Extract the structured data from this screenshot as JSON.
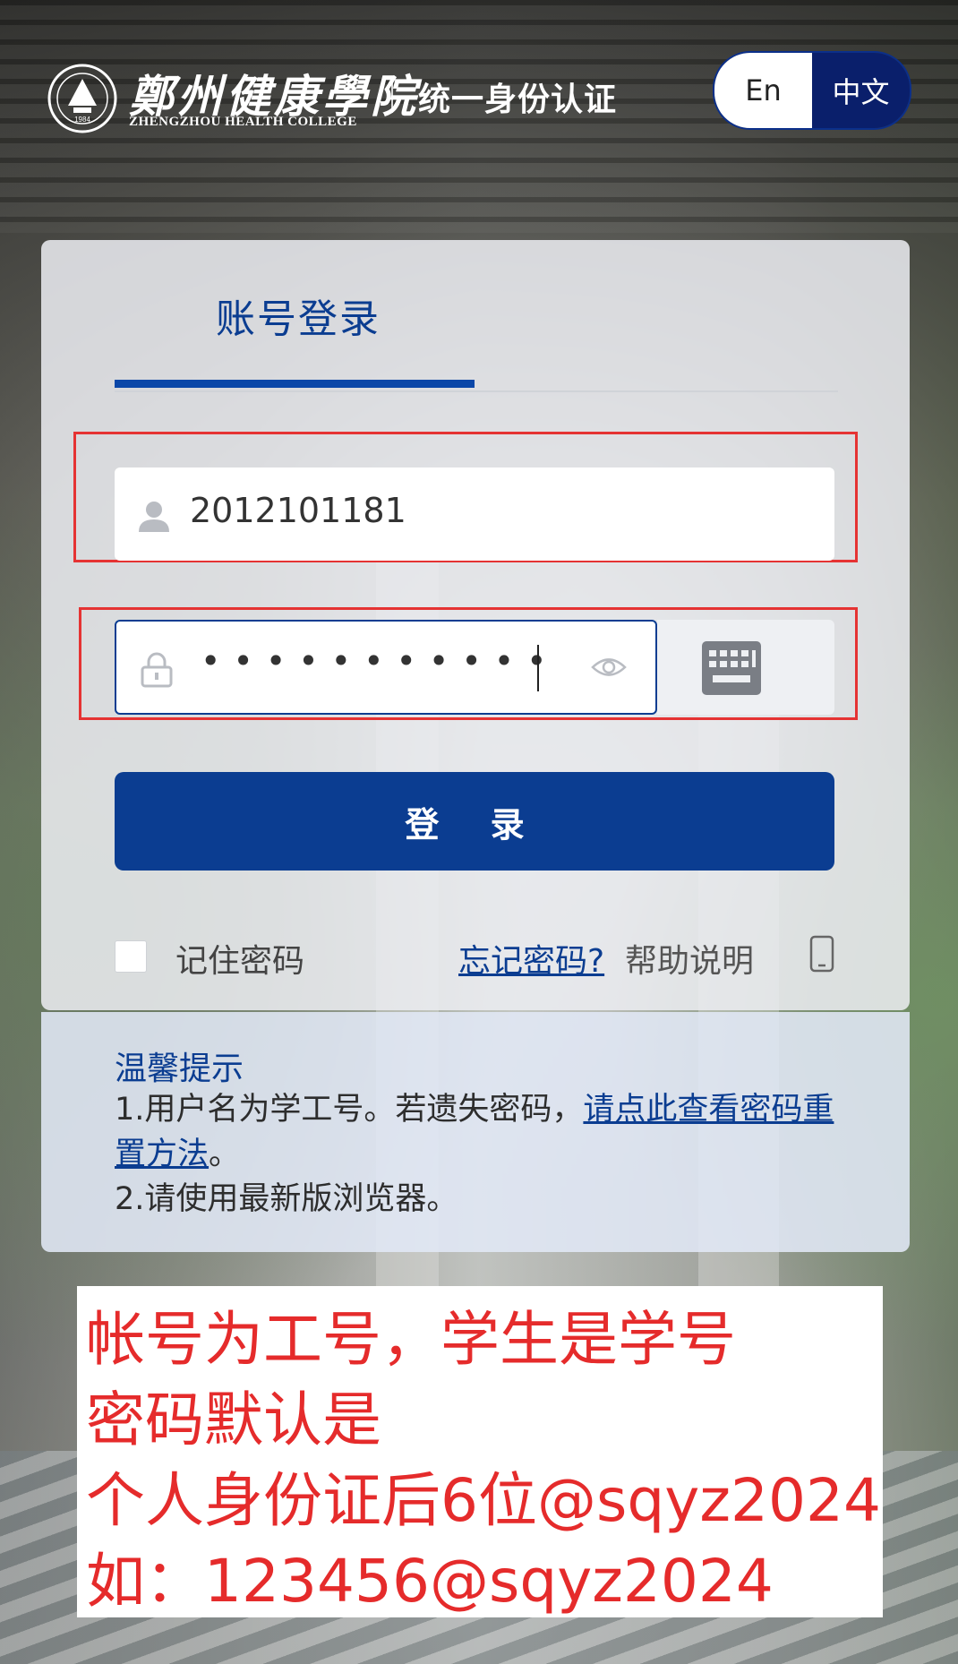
{
  "header": {
    "logo_cn": "鄭州健康學院",
    "logo_en": "ZHENGZHOU HEALTH COLLEGE",
    "logo_year": "1984",
    "title": "统一身份认证"
  },
  "language": {
    "en_label": "En",
    "zh_label": "中文",
    "selected": "中文"
  },
  "login": {
    "tab_label": "账号登录",
    "username_value": "2012101181",
    "password_mask": "•••••••••••",
    "submit_label": "登 录",
    "remember_label": "记住密码",
    "remember_checked": false,
    "forgot_label": "忘记密码?",
    "help_label": "帮助说明"
  },
  "tips": {
    "title": "温馨提示",
    "line1_prefix": "1.用户名为学工号。若遗失密码，",
    "line1_link": "请点此查看密码重置方法",
    "line1_suffix": "。",
    "line2": "2.请使用最新版浏览器。"
  },
  "annotation": {
    "line1": "帐号为工号，学生是学号",
    "line2": "密码默认是",
    "line3": "个人身份证后6位@sqyz2024",
    "line4": "如：123456@sqyz2024"
  },
  "colors": {
    "primary": "#0b3d91",
    "annotation_red": "#e52b2b",
    "highlight_box": "#e53333"
  }
}
